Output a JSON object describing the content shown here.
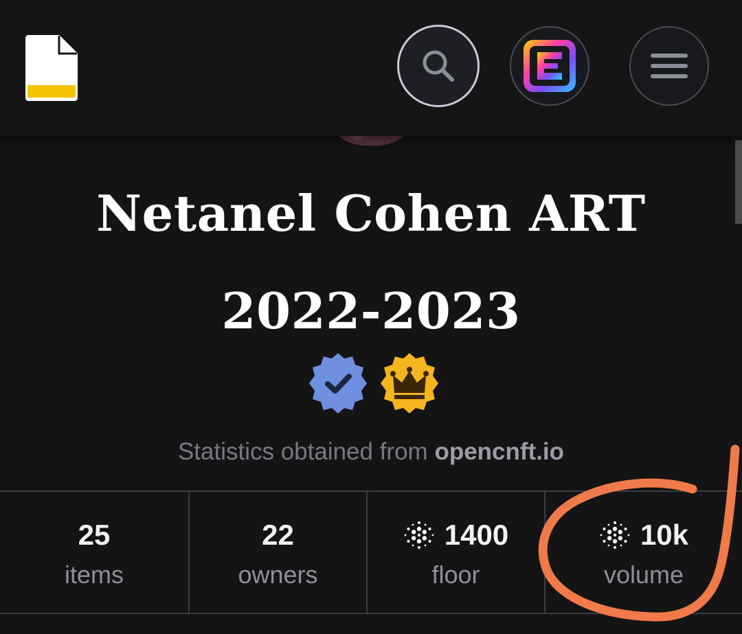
{
  "header": {
    "logo_icon": "document-logo-icon",
    "search_icon": "search-icon",
    "app_icon": "rainbow-e-app-icon",
    "menu_icon": "hamburger-menu-icon"
  },
  "title": {
    "line1": "Netanel Cohen ART",
    "line2": "2022-2023"
  },
  "badges": [
    {
      "name": "verified-badge-icon",
      "color": "#6f8fe0"
    },
    {
      "name": "crown-badge-icon",
      "color": "#f4b51f"
    }
  ],
  "stats_source": {
    "prefix": "Statistics obtained from",
    "domain": "opencnft.io"
  },
  "stats": [
    {
      "value": "25",
      "label": "items",
      "icon": ""
    },
    {
      "value": "22",
      "label": "owners",
      "icon": ""
    },
    {
      "value": "1400",
      "label": "floor",
      "icon": "ada-icon"
    },
    {
      "value": "10k",
      "label": "volume",
      "icon": "ada-icon"
    }
  ],
  "annotation": {
    "color": "#f07a4a",
    "icon": "orange-circle-annotation"
  }
}
